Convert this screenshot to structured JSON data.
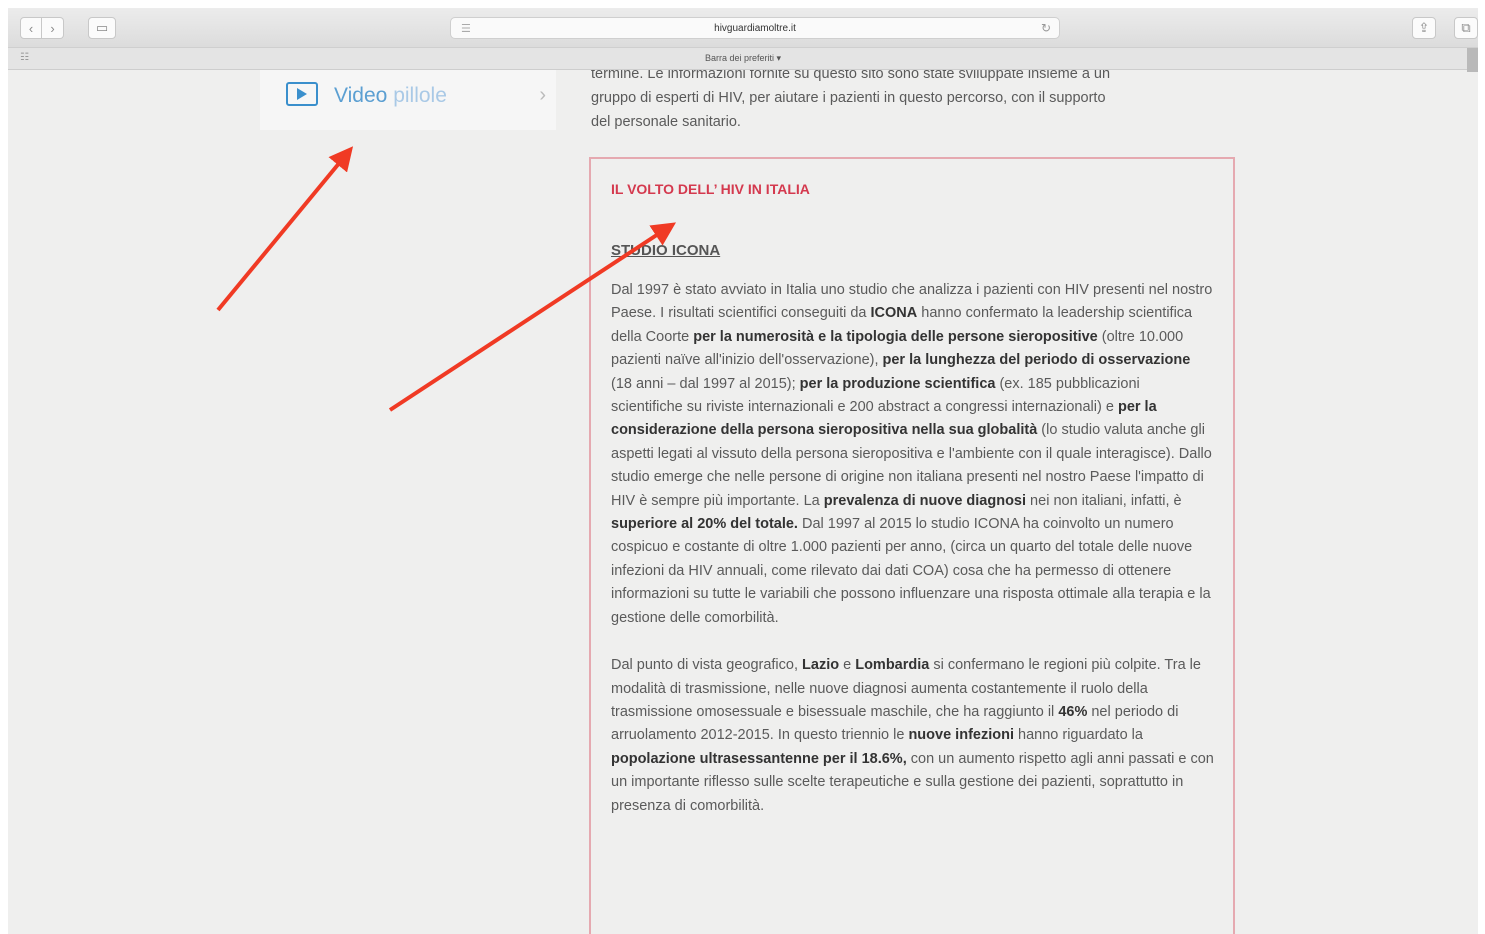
{
  "browser": {
    "url": "hivguardiamoltre.it",
    "bookmarks_label": "Barra dei preferiti ▾",
    "back_label": "‹",
    "forward_label": "›"
  },
  "sidebar": {
    "video_card": {
      "word1": "Video",
      "word2": "pillole",
      "chevron": "›"
    }
  },
  "main": {
    "intro_lines": [
      "termine. Le informazioni fornite su questo sito sono state sviluppate insieme a un",
      "gruppo di esperti di HIV, per aiutare i pazienti in questo percorso, con il supporto",
      "del personale sanitario."
    ],
    "box": {
      "title": "IL VOLTO DELL’ HIV IN ITALIA",
      "heading": "STUDIO ICONA",
      "p1": [
        {
          "t": "Dal 1997 è stato avviato in Italia uno studio che analizza i pazienti con HIV presenti nel nostro Paese. I risultati scientifici conseguiti da "
        },
        {
          "t": "ICONA",
          "b": true
        },
        {
          "t": " hanno confermato la leadership scientifica della Coorte "
        },
        {
          "t": "per la numerosità e la tipologia delle persone sieropositive",
          "b": true
        },
        {
          "t": " (oltre 10.000 pazienti naïve all'inizio dell'osservazione), "
        },
        {
          "t": "per la lunghezza del periodo di osservazione",
          "b": true
        },
        {
          "t": " (18 anni – dal 1997 al 2015); "
        },
        {
          "t": "per la produzione scientifica",
          "b": true
        },
        {
          "t": " (ex. 185 pubblicazioni scientifiche su riviste internazionali e 200 abstract a congressi internazionali) e "
        },
        {
          "t": "per la considerazione della persona sieropositiva nella sua globalità",
          "b": true
        },
        {
          "t": " (lo studio valuta anche gli aspetti legati al vissuto della persona sieropositiva e l'ambiente con il quale interagisce). Dallo studio emerge che nelle persone di origine non italiana presenti nel nostro Paese l'impatto di HIV è sempre più importante. La "
        },
        {
          "t": "prevalenza di nuove diagnosi",
          "b": true
        },
        {
          "t": " nei non italiani, infatti, è "
        },
        {
          "t": "superiore al 20% del totale.",
          "b": true
        },
        {
          "t": " Dal 1997 al 2015 lo studio ICONA ha coinvolto un numero cospicuo e costante di oltre 1.000 pazienti per anno, (circa un quarto del totale delle nuove infezioni da HIV annuali, come rilevato dai dati COA) cosa che ha permesso di ottenere informazioni su tutte le variabili che possono influenzare una risposta ottimale alla terapia e la gestione delle comorbilità."
        }
      ],
      "p2": [
        {
          "t": "Dal punto di vista geografico, "
        },
        {
          "t": "Lazio",
          "b": true
        },
        {
          "t": " e "
        },
        {
          "t": "Lombardia",
          "b": true
        },
        {
          "t": " si confermano le regioni più colpite. Tra le modalità di trasmissione, nelle nuove diagnosi aumenta costantemente il ruolo della trasmissione omosessuale e bisessuale maschile, che ha raggiunto il "
        },
        {
          "t": "46%",
          "b": true
        },
        {
          "t": " nel periodo di arruolamento 2012-2015. In questo triennio le "
        },
        {
          "t": "nuove infezioni",
          "b": true
        },
        {
          "t": " hanno riguardato la "
        },
        {
          "t": "popolazione ultrasessantenne per il 18.6%,",
          "b": true
        },
        {
          "t": " con un aumento rispetto agli anni passati e con un importante riflesso sulle scelte terapeutiche e sulla gestione dei pazienti, soprattutto in presenza di comorbilità."
        }
      ]
    }
  },
  "colors": {
    "arrow": "#f03a24",
    "title": "#d4394e",
    "accent": "#3a8fcc"
  }
}
